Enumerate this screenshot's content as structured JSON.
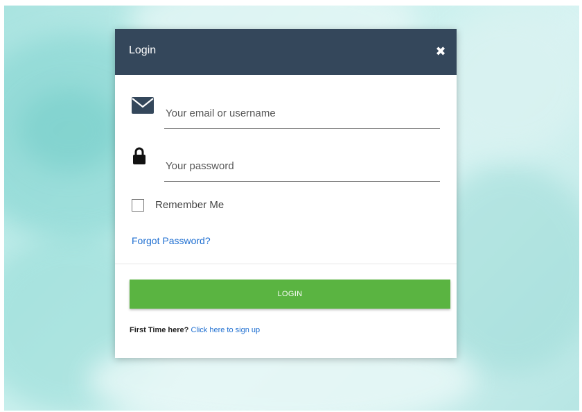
{
  "dialog": {
    "title": "Login",
    "close_label": "✖"
  },
  "form": {
    "email_placeholder": "Your email or username",
    "password_placeholder": "Your password",
    "remember_label": "Remember Me",
    "forgot_link": "Forgot Password?",
    "login_button": "LOGIN"
  },
  "signup": {
    "prefix": "First Time here?",
    "link": "Click here to sign up"
  },
  "icons": {
    "email": "envelope-icon",
    "password": "lock-icon",
    "close": "close-icon"
  },
  "colors": {
    "header": "#34475b",
    "login_button": "#5ab441",
    "link": "#1f6fd1"
  }
}
